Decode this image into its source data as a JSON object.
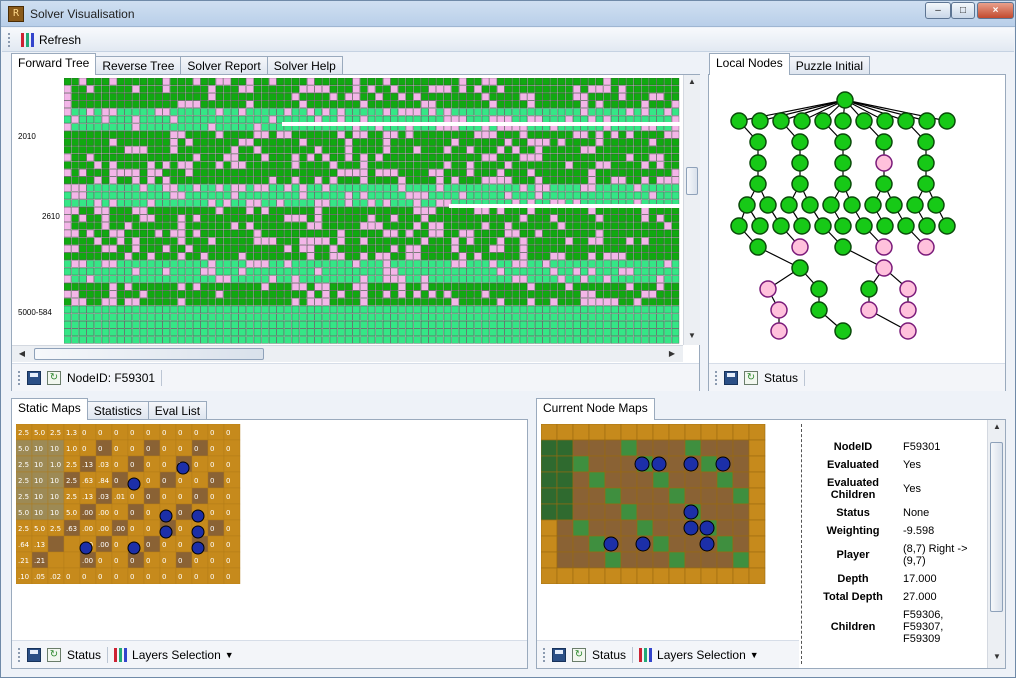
{
  "window": {
    "title": "Solver Visualisation",
    "app_icon_text": "R"
  },
  "toolbar": {
    "refresh_label": "Refresh"
  },
  "forward_panel": {
    "tabs": [
      "Forward Tree",
      "Reverse Tree",
      "Solver Report",
      "Solver Help"
    ],
    "row_labels": [
      "2010",
      "2610",
      "5000-584"
    ],
    "status": "NodeID: F59301"
  },
  "local_panel": {
    "tabs": [
      "Local Nodes",
      "Puzzle Initial"
    ],
    "status": "Status"
  },
  "static_panel": {
    "tabs": [
      "Static Maps",
      "Statistics",
      "Eval List"
    ],
    "status": "Status",
    "layers_label": "Layers Selection",
    "grid_rows": [
      [
        "2.5",
        "5.0",
        "2.5",
        "1.3",
        "0",
        "0",
        "0",
        "0",
        "0",
        "0",
        "0",
        "0",
        "0",
        "0"
      ],
      [
        "5.0",
        "10",
        "10",
        "1.0",
        "0",
        "0",
        "0",
        "0",
        "0",
        "0",
        "0",
        "0",
        "0",
        "0"
      ],
      [
        "2.5",
        "10",
        "1.0",
        "2.5",
        ".13",
        ".03",
        "0",
        "0",
        "0",
        "0",
        "0",
        "0",
        "0",
        "0"
      ],
      [
        "2.5",
        "10",
        "10",
        "2.5",
        ".63",
        ".84",
        "0",
        "0",
        "0",
        "0",
        "0",
        "0",
        "0",
        "0"
      ],
      [
        "2.5",
        "10",
        "10",
        "2.5",
        ".13",
        ".03",
        ".01",
        "0",
        "0",
        "0",
        "0",
        "0",
        "0",
        "0"
      ],
      [
        "5.0",
        "10",
        "10",
        "5.0",
        ".00",
        ".00",
        "0",
        "0",
        "0",
        "0",
        "0",
        "0",
        "0",
        "0"
      ],
      [
        "2.5",
        "5.0",
        "2.5",
        ".63",
        ".00",
        ".00",
        ".00",
        "0",
        "0",
        "0",
        "0",
        "0",
        "0",
        "0"
      ],
      [
        ".64",
        ".13",
        "",
        "",
        ".00",
        ".00",
        "0",
        "0",
        "0",
        "0",
        "0",
        "0",
        "0",
        "0"
      ],
      [
        ".21",
        ".21",
        "",
        "",
        ".00",
        "0",
        "0",
        "0",
        "0",
        "0",
        "0",
        "0",
        "0",
        "0"
      ],
      [
        ".10",
        ".05",
        ".02",
        "0",
        "0",
        "0",
        "0",
        "0",
        "0",
        "0",
        "0",
        "0",
        "0",
        "0"
      ]
    ]
  },
  "current_panel": {
    "tabs": [
      "Current Node Maps"
    ],
    "status": "Status",
    "layers_label": "Layers Selection",
    "details": [
      {
        "key": "NodeID",
        "value": "F59301"
      },
      {
        "key": "Evaluated",
        "value": "Yes"
      },
      {
        "key": "Evaluated Children",
        "value": "Yes"
      },
      {
        "key": "Status",
        "value": "None"
      },
      {
        "key": "Weighting",
        "value": "-9.598"
      },
      {
        "key": "Player",
        "value": "(8,7) Right -> (9,7)"
      },
      {
        "key": "Depth",
        "value": "17.000"
      },
      {
        "key": "Total Depth",
        "value": "27.000"
      },
      {
        "key": "Children",
        "value": "F59306, F59307, F59309"
      }
    ]
  },
  "colors": {
    "node_green": "#17c917",
    "node_pink": "#ffc1dc",
    "grid_dark": "#11a811",
    "grid_light": "#35e686",
    "grid_pink": "#f3b6e8",
    "wall": "#c68a1c",
    "floor": "#8a6234",
    "goal": "#3f8f3f"
  },
  "icons": [
    "refresh-icon",
    "save-icon",
    "layers-icon",
    "gear-icon"
  ]
}
